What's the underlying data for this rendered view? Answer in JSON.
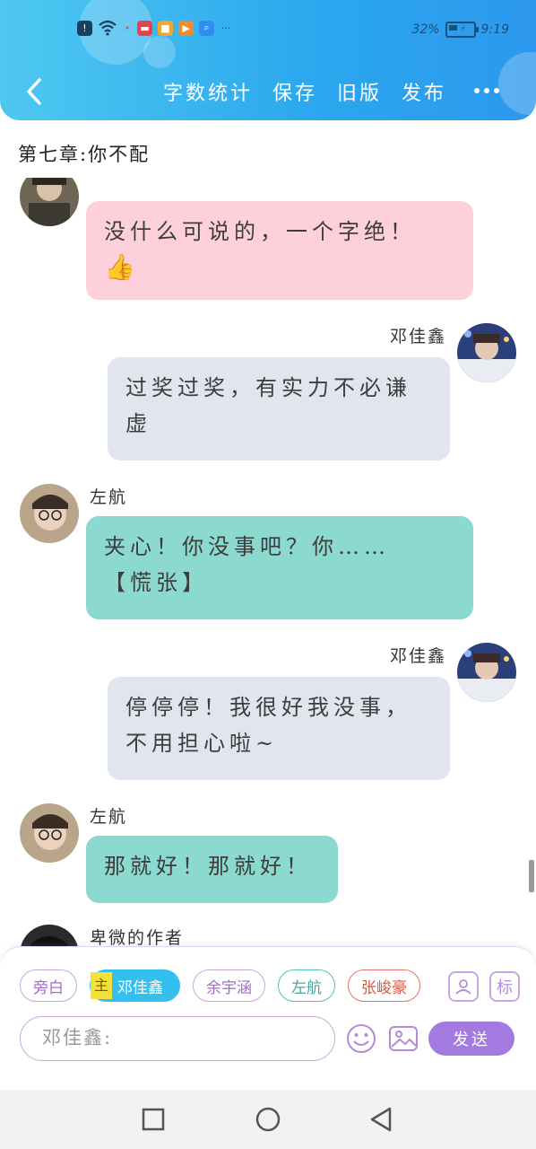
{
  "status_bar": {
    "battery": "32%",
    "time": "9:19"
  },
  "header": {
    "back_icon": "chevron-left-icon",
    "actions": [
      "字数统计",
      "保存",
      "旧版",
      "发布"
    ],
    "more_icon": "more-dots-icon"
  },
  "chapter": {
    "title": "第七章:你不配"
  },
  "messages": [
    {
      "name": "",
      "side": "left",
      "text_lines": [
        "没什么可说的，一个字绝！"
      ],
      "emoji": "👍",
      "color": "pink"
    },
    {
      "name": "邓佳鑫",
      "side": "right",
      "text_lines": [
        "过奖过奖，有实力不必谦",
        "虚"
      ],
      "color": "gray"
    },
    {
      "name": "左航",
      "side": "left",
      "text_lines": [
        "夹心！你没事吧？你……",
        "【慌张】"
      ],
      "color": "teal"
    },
    {
      "name": "邓佳鑫",
      "side": "right",
      "text_lines": [
        "停停停！我很好我没事，",
        "不用担心啦~"
      ],
      "color": "gray"
    },
    {
      "name": "左航",
      "side": "left",
      "text_lines": [
        "那就好！那就好！"
      ],
      "color": "teal"
    },
    {
      "name": "卑微的作者",
      "side": "left",
      "text_lines": [],
      "color": "none"
    }
  ],
  "composer": {
    "roles": [
      {
        "label": "旁白"
      },
      {
        "label": "邓佳鑫",
        "tag": "主"
      },
      {
        "label": "余宇涵"
      },
      {
        "label": "左航"
      },
      {
        "label": "张峻豪"
      }
    ],
    "role_manage_icon": "person-card-icon",
    "mark_label": "标",
    "input_placeholder": "邓佳鑫:",
    "send_label": "发送",
    "emoji_icon": "smiley-icon",
    "image_icon": "image-icon"
  },
  "colors": {
    "header_start": "#4fc8f0",
    "header_end": "#2d98ee",
    "pink_bubble": "#fdd0dc",
    "gray_bubble": "#e1e5ee",
    "teal_bubble": "#8cd9d0",
    "accent_purple": "#a37be0"
  }
}
